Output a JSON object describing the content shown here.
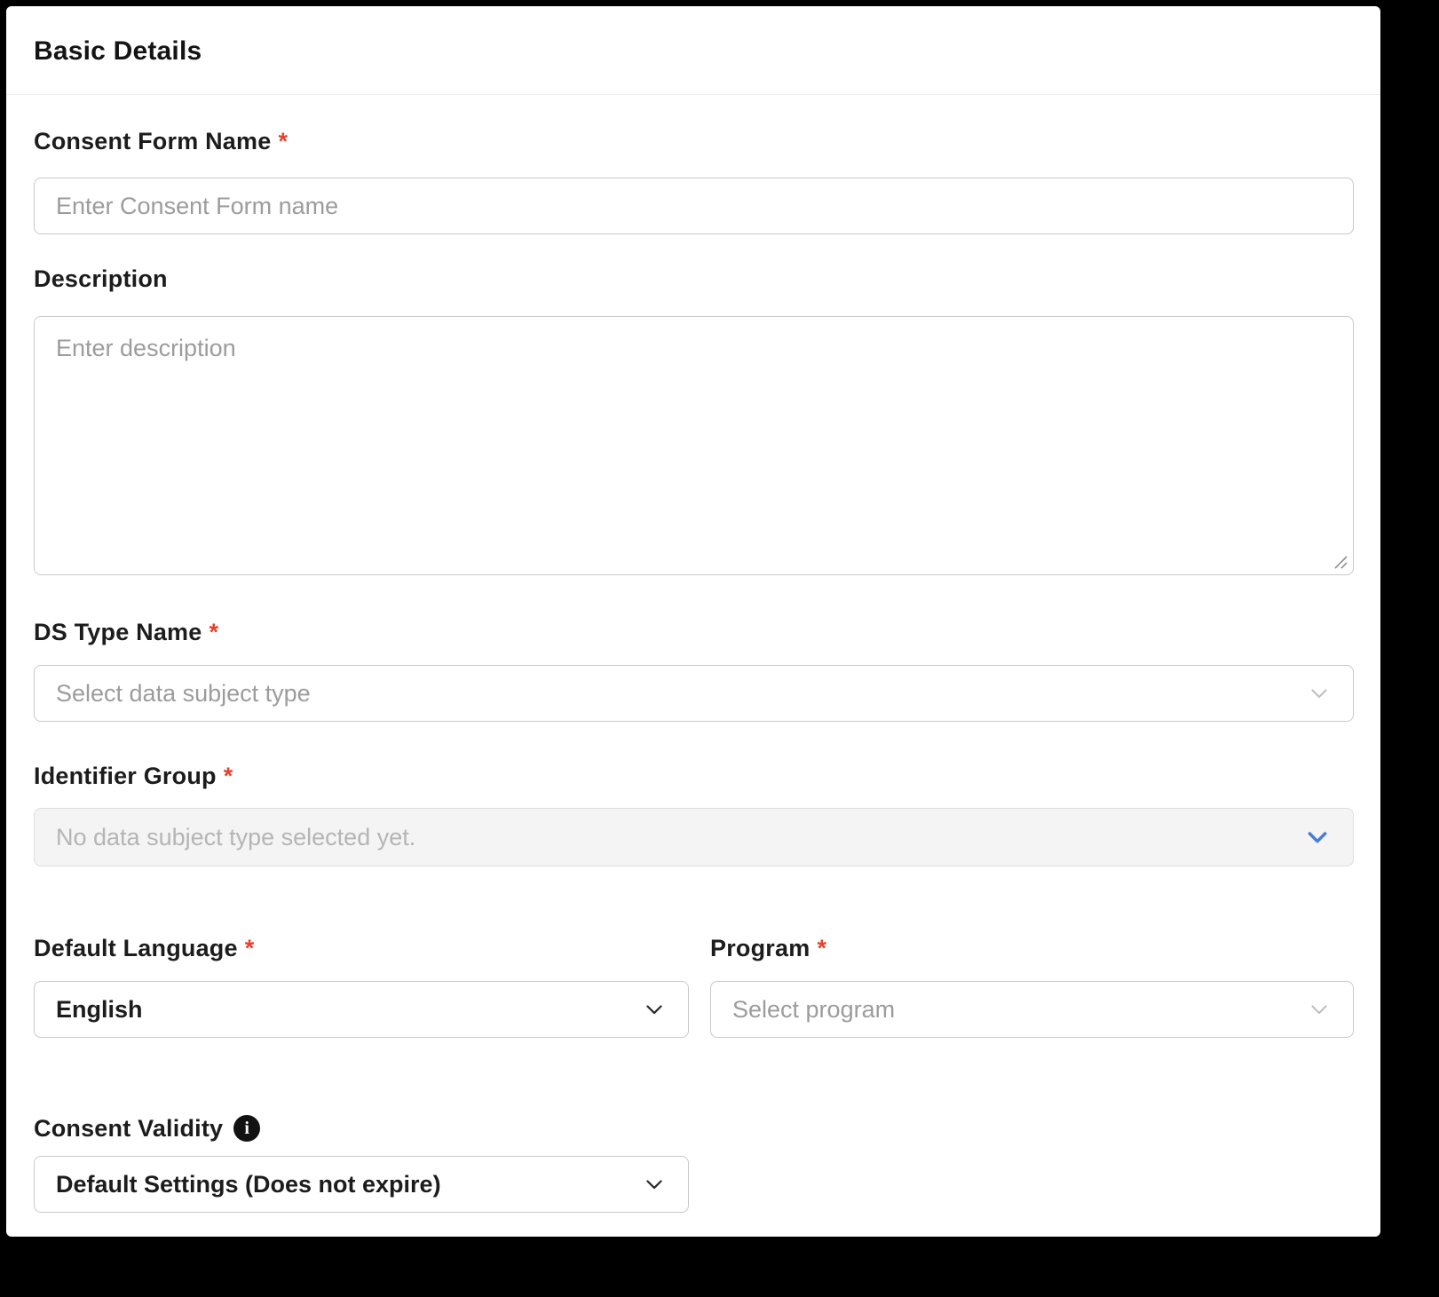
{
  "card": {
    "title": "Basic Details"
  },
  "required_marker": "*",
  "fields": {
    "consent_form_name": {
      "label": "Consent Form Name",
      "required": true,
      "placeholder": "Enter Consent Form name",
      "value": ""
    },
    "description": {
      "label": "Description",
      "required": false,
      "placeholder": "Enter description",
      "value": ""
    },
    "ds_type_name": {
      "label": "DS Type Name",
      "required": true,
      "placeholder": "Select data subject type"
    },
    "identifier_group": {
      "label": "Identifier Group",
      "required": true,
      "placeholder": "No data subject type selected yet.",
      "disabled": true
    },
    "default_language": {
      "label": "Default Language",
      "required": true,
      "value": "English"
    },
    "program": {
      "label": "Program",
      "required": true,
      "placeholder": "Select program"
    },
    "consent_validity": {
      "label": "Consent Validity",
      "required": false,
      "value": "Default Settings (Does not expire)"
    }
  },
  "icons": {
    "info": "info-icon",
    "chevron_down": "chevron-down-icon",
    "resize_handle": "resize-handle-icon"
  },
  "info_glyph": "i",
  "colors": {
    "page_background": "#000000",
    "card_background": "#ffffff",
    "required_asterisk": "#e8402d",
    "accent_chevron_blue": "#4a7bd8",
    "disabled_field_background": "#f4f4f4",
    "placeholder_text": "#9c9c9c",
    "label_text": "#1c1c1c",
    "field_border": "#c9c9c9"
  }
}
